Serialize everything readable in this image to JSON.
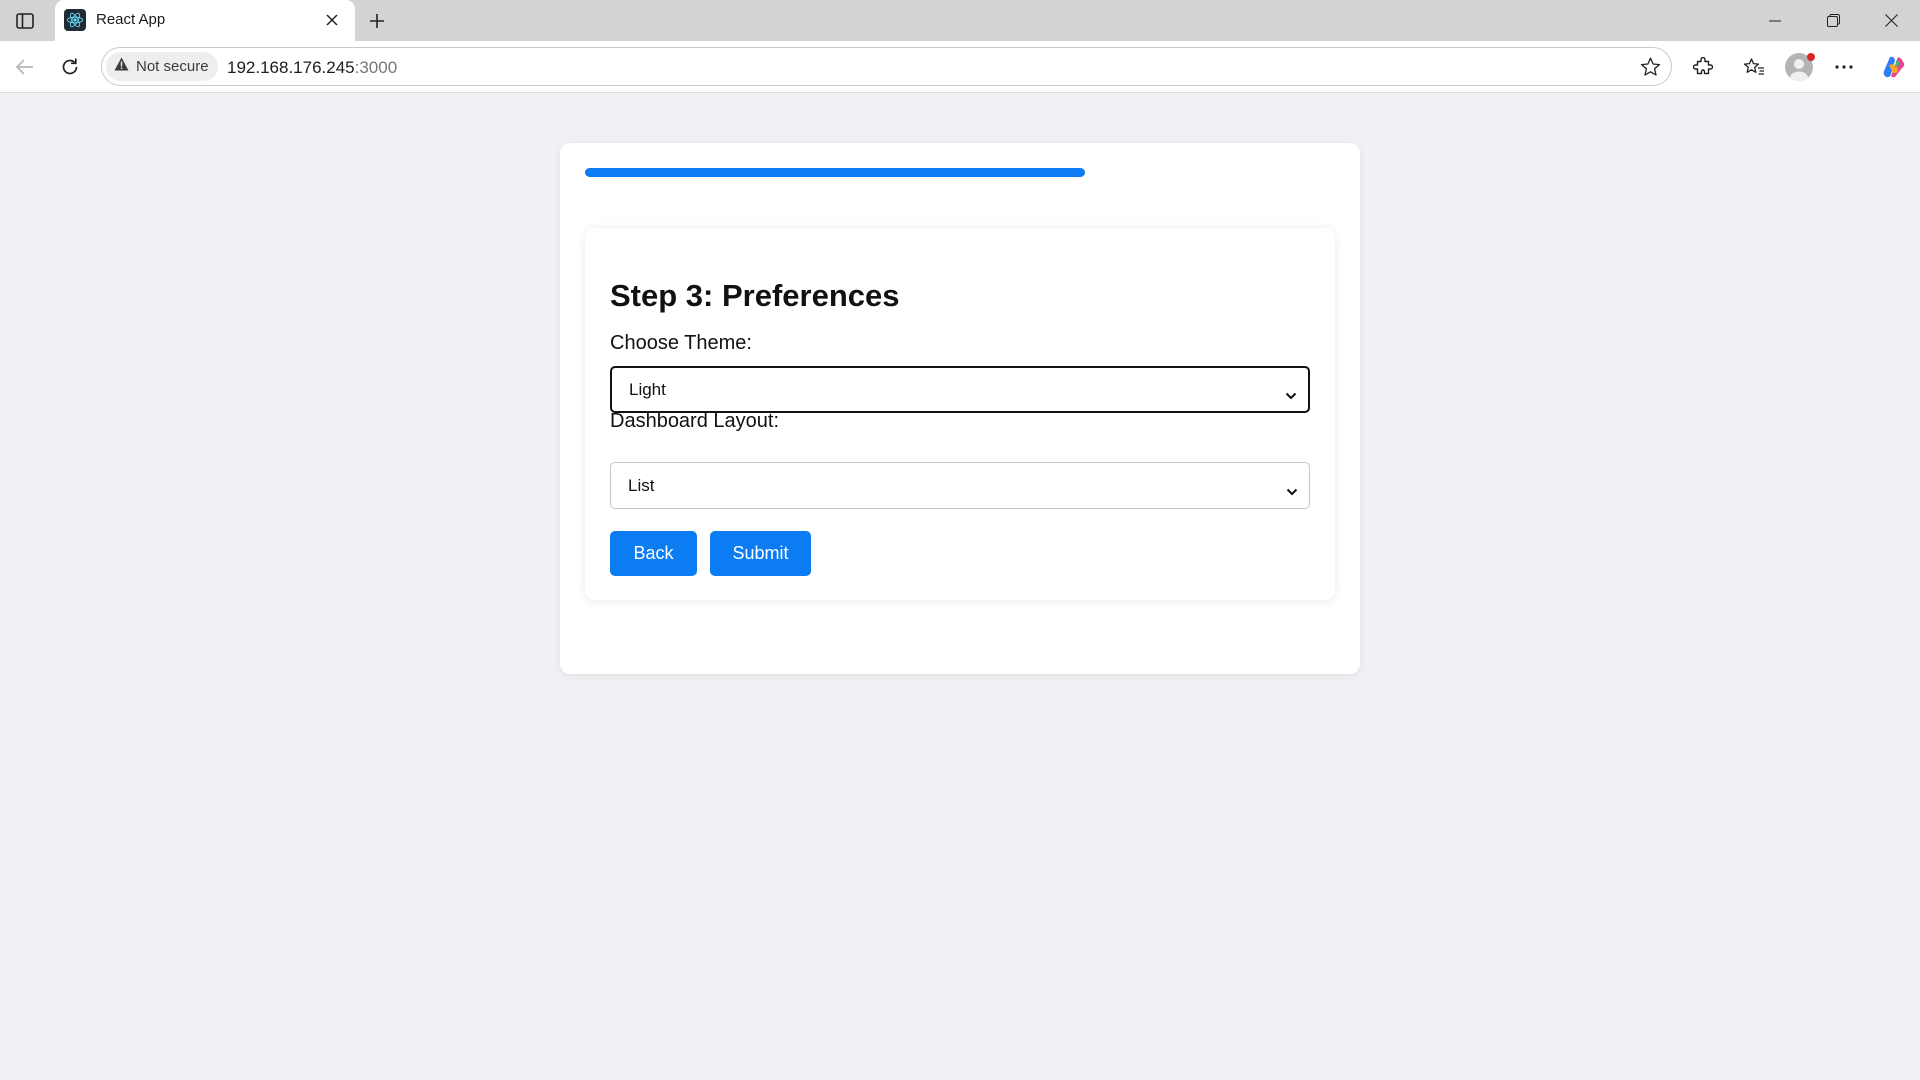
{
  "browser": {
    "tab_title": "React App",
    "security_label": "Not secure",
    "url_host": "192.168.176.245",
    "url_port": ":3000"
  },
  "page": {
    "progress_fraction": 0.667,
    "step_title": "Step 3: Preferences",
    "theme_label": "Choose Theme:",
    "theme_value": "Light",
    "layout_label": "Dashboard Layout:",
    "layout_value": "List",
    "back_label": "Back",
    "submit_label": "Submit"
  },
  "colors": {
    "accent": "#0b7cf1",
    "page_background": "#f0f1f4",
    "card_background": "#ffffff"
  },
  "icons": [
    "sidebar-toggle-icon",
    "react-favicon-icon",
    "close-icon",
    "plus-icon",
    "minimize-icon",
    "restore-icon",
    "back-arrow-icon",
    "reload-icon",
    "warning-icon",
    "star-icon",
    "extensions-icon",
    "favorites-icon",
    "profile-icon",
    "more-icon",
    "copilot-icon",
    "chevron-down-icon"
  ]
}
